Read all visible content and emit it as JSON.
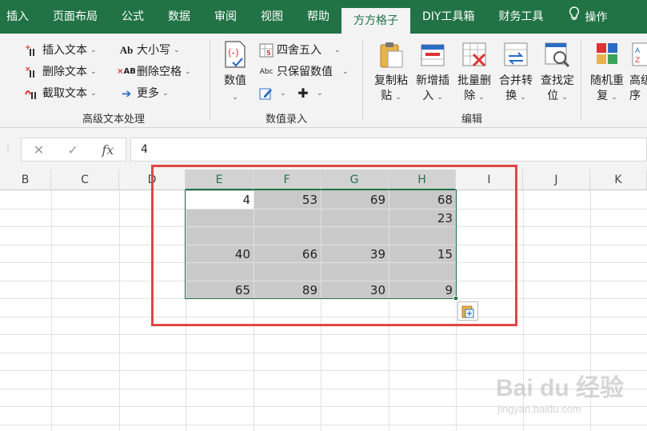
{
  "tabs": [
    {
      "label": "插入",
      "active": false
    },
    {
      "label": "页面布局",
      "active": false
    },
    {
      "label": "公式",
      "active": false
    },
    {
      "label": "数据",
      "active": false
    },
    {
      "label": "审阅",
      "active": false
    },
    {
      "label": "视图",
      "active": false
    },
    {
      "label": "帮助",
      "active": false
    },
    {
      "label": "方方格子",
      "active": true
    },
    {
      "label": "DIY工具箱",
      "active": false
    },
    {
      "label": "财务工具",
      "active": false
    }
  ],
  "tell_me": {
    "icon": "lightbulb-icon",
    "label": "操作"
  },
  "groups": {
    "text": {
      "label": "高级文本处理",
      "insert_text": "插入文本",
      "delete_text": "删除文本",
      "extract_text": "截取文本",
      "case": "大小写",
      "remove_space": "删除空格",
      "more": "更多"
    },
    "number": {
      "label": "数值录入",
      "value": "数值",
      "round": "四舍五入",
      "keep_value": "只保留数值"
    },
    "edit": {
      "label": "编辑",
      "copy_paste": [
        "复制粘",
        "贴"
      ],
      "new_insert": [
        "新增插",
        "入"
      ],
      "batch_delete": [
        "批量删",
        "除"
      ],
      "merge_convert": [
        "合并转",
        "换"
      ],
      "find_locate": [
        "查找定",
        "位"
      ],
      "random_repeat": [
        "随机重",
        "复"
      ],
      "advanced_sort": [
        "高级",
        "序"
      ]
    }
  },
  "formula_bar": {
    "cancel": "✕",
    "confirm": "✓",
    "fx": "fx",
    "value": "4"
  },
  "columns": [
    "B",
    "C",
    "D",
    "E",
    "F",
    "G",
    "H",
    "I",
    "J",
    "K"
  ],
  "selected_columns": [
    "E",
    "F",
    "G",
    "H"
  ],
  "cells": {
    "r1": [
      "4",
      "53",
      "69",
      "68"
    ],
    "r2": [
      "",
      "",
      "",
      "23"
    ],
    "r4": [
      "40",
      "66",
      "39",
      "15"
    ],
    "r6": [
      "65",
      "89",
      "30",
      "9"
    ]
  },
  "colors": {
    "excel_green": "#217346",
    "highlight_red": "#e04545",
    "selection_gray": "#c9c9c9"
  },
  "watermark": {
    "logo": "Bai du 经验",
    "url": "jingyan.baidu.com"
  }
}
